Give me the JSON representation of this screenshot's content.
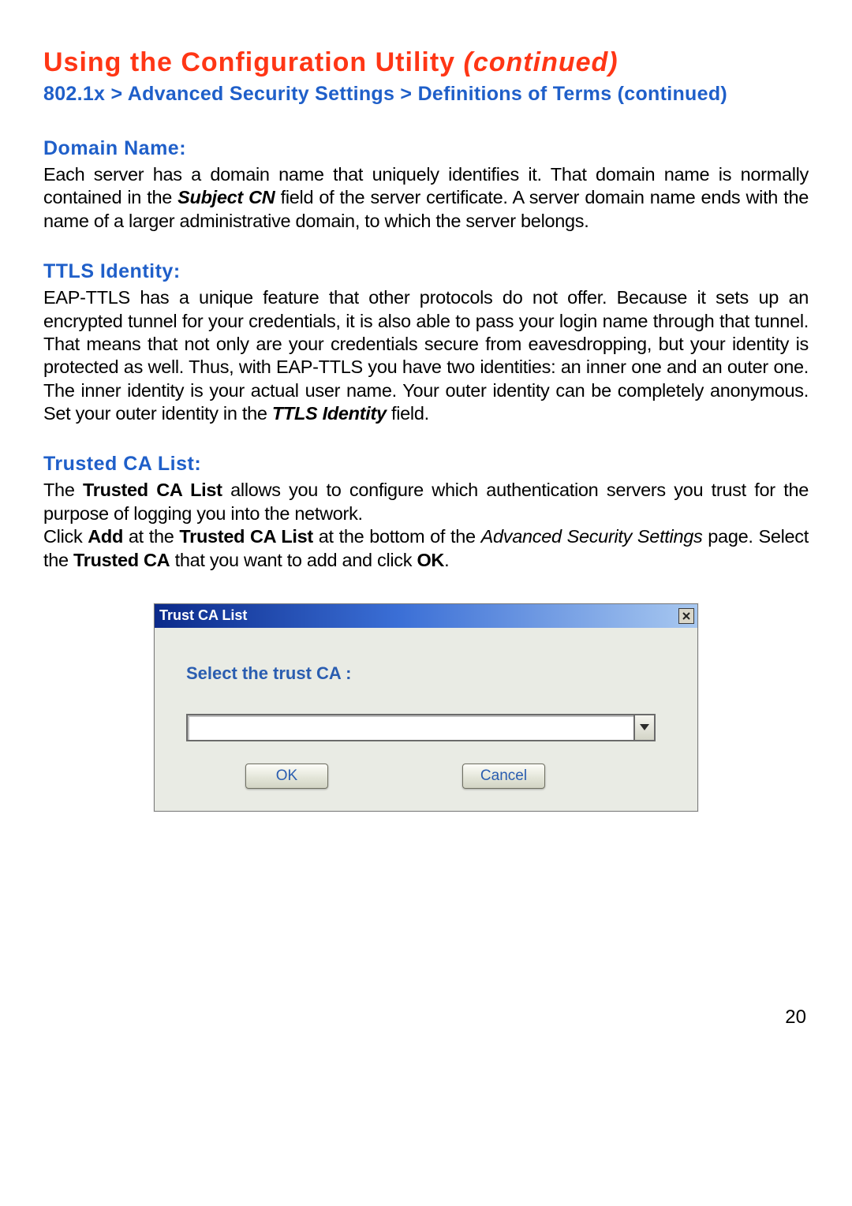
{
  "title_main": "Using the Configuration Utility ",
  "title_continued": "(continued)",
  "breadcrumb": "802.1x > Advanced Security Settings > Definitions of Terms (continued)",
  "sections": {
    "domain": {
      "heading": "Domain Name:",
      "p1a": "Each server has a domain name that uniquely identifies it. That domain name is normally contained in the ",
      "p1b": "Subject CN",
      "p1c": " field of the server certificate. A server domain name ends with the name of a larger administrative domain, to which the server belongs."
    },
    "ttls": {
      "heading": "TTLS Identity:",
      "p1a": "EAP-TTLS has a unique feature that other protocols do not offer. Because it sets up an encrypted tunnel for your credentials, it is also able to pass your login name through that tunnel. That means that not only are your credentials secure from eavesdropping, but your identity is protected as well. Thus, with EAP-TTLS you have two identities: an inner one and an outer one. The inner identity is your actual user name. Your outer identity can be completely anonymous. Set your outer identity in the ",
      "p1b": "TTLS Identity",
      "p1c": " field."
    },
    "calist": {
      "heading": "Trusted CA List:",
      "p1a": "The ",
      "p1b": "Trusted CA List",
      "p1c": " allows you to configure which authentication servers you trust for the purpose of logging you into the network.",
      "p2a": "Click ",
      "p2b": "Add",
      "p2c": " at the ",
      "p2d": "Trusted CA List",
      "p2e": " at the bottom of the ",
      "p2f": "Advanced Security Settings",
      "p2g": " page. Select the ",
      "p2h": "Trusted CA",
      "p2i": " that you want to add and click ",
      "p2j": "OK",
      "p2k": "."
    }
  },
  "dialog": {
    "title": "Trust CA List",
    "label": "Select the trust CA :",
    "combo_value": "",
    "ok": "OK",
    "cancel": "Cancel"
  },
  "page_number": "20"
}
